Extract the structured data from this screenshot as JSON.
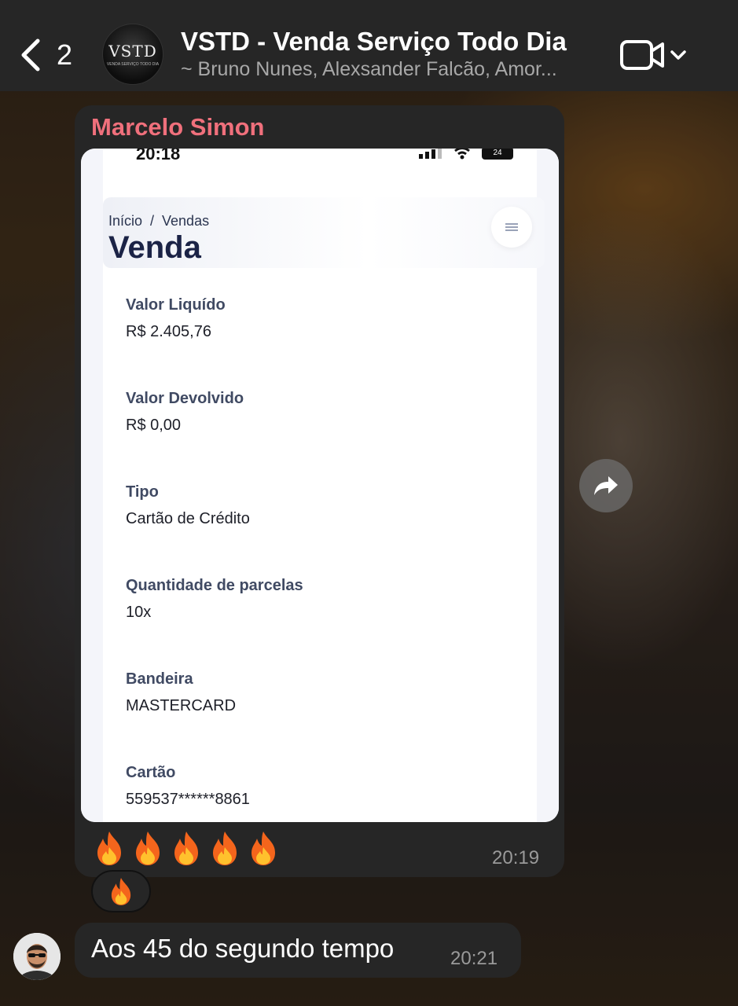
{
  "header": {
    "back_count": "2",
    "group_avatar_logo": "VSTD",
    "group_avatar_sub": "VENDA SERVIÇO TODO DIA",
    "group_title": "VSTD - Venda Serviço Todo Dia",
    "members": "~ Bruno Nunes, Alexsander Falcão, Amor..."
  },
  "message1": {
    "sender": "Marcelo Simon",
    "emojis": [
      "🔥",
      "🔥",
      "🔥",
      "🔥",
      "🔥"
    ],
    "time": "20:19",
    "reaction": "🔥"
  },
  "screenshot": {
    "status_time": "20:18",
    "battery": "24",
    "breadcrumb": "Início  /  Vendas",
    "title": "Venda",
    "fields": [
      {
        "label": "Valor Liquído",
        "value": "R$ 2.405,76"
      },
      {
        "label": "Valor Devolvido",
        "value": "R$ 0,00"
      },
      {
        "label": "Tipo",
        "value": "Cartão de Crédito"
      },
      {
        "label": "Quantidade de parcelas",
        "value": "10x"
      },
      {
        "label": "Bandeira",
        "value": "MASTERCARD"
      },
      {
        "label": "Cartão",
        "value": "559537******8861"
      }
    ]
  },
  "message2": {
    "text": "Aos 45 do segundo tempo",
    "time": "20:21"
  },
  "colors": {
    "sender_name": "#f0707c",
    "bubble": "#262626",
    "header": "#262626",
    "title_navy": "#1b2346"
  },
  "icons": [
    "chevron-left-icon",
    "video-camera-icon",
    "chevron-down-icon",
    "forward-icon",
    "menu-icon",
    "fire-emoji"
  ]
}
